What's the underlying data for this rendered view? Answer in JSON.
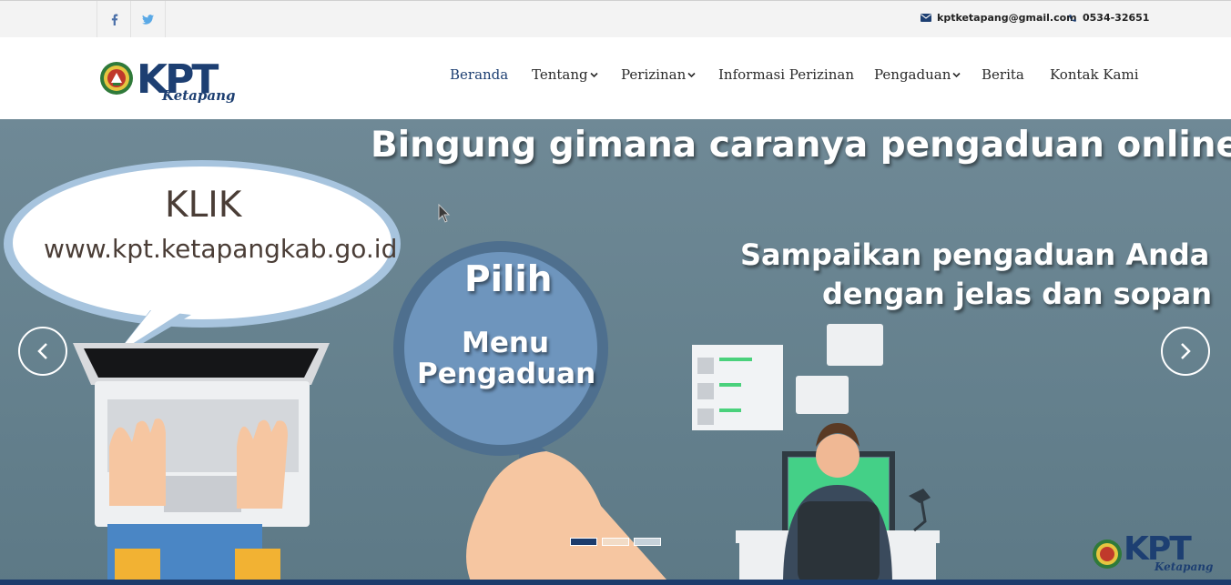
{
  "topbar": {
    "social": [
      {
        "name": "facebook-icon"
      },
      {
        "name": "twitter-icon"
      }
    ],
    "email": "kptketapang@gmail.com",
    "phone": "0534-32651"
  },
  "header": {
    "logo_text_big": "KPT",
    "logo_text_small": "Ketapang",
    "nav": [
      {
        "label": "Beranda",
        "active": true,
        "dropdown": false
      },
      {
        "label": "Tentang",
        "active": false,
        "dropdown": true
      },
      {
        "label": "Perizinan",
        "active": false,
        "dropdown": true
      },
      {
        "label": "Informasi Perizinan",
        "active": false,
        "dropdown": false
      },
      {
        "label": "Pengaduan",
        "active": false,
        "dropdown": true
      },
      {
        "label": "Berita",
        "active": false,
        "dropdown": false
      },
      {
        "label": "Kontak Kami",
        "active": false,
        "dropdown": false
      }
    ]
  },
  "slider": {
    "headline": "Bingung gimana caranya pengaduan online?",
    "bubble_line1": "KLIK",
    "bubble_line2": "www.kpt.ketapangkab.go.id",
    "magnifier_line1": "Pilih",
    "magnifier_line2": "Menu",
    "magnifier_line3": "Pengaduan",
    "right_line1": "Sampaikan pengaduan Anda",
    "right_line2": "dengan jelas dan sopan",
    "watermark_big": "KPT",
    "watermark_small": "Ketapang",
    "prev_icon": "chevron-left-icon",
    "next_icon": "chevron-right-icon",
    "indicators": [
      {
        "active": true
      },
      {
        "active": false
      },
      {
        "active": false
      }
    ]
  },
  "colors": {
    "brand_navy": "#1d3f72",
    "slider_bg": "#6a8592",
    "indicator_active": "#1c3c6c",
    "indicator_inactive": "#f2dcc7"
  }
}
